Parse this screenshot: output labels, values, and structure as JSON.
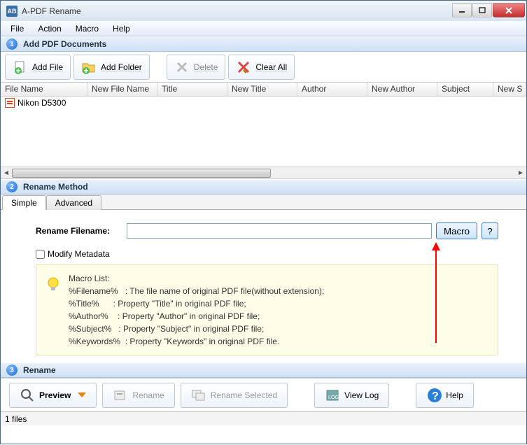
{
  "window": {
    "title": "A-PDF Rename"
  },
  "menu": {
    "file": "File",
    "action": "Action",
    "macro": "Macro",
    "help": "Help"
  },
  "sections": {
    "s1": "Add PDF Documents",
    "s2": "Rename Method",
    "s3": "Rename"
  },
  "toolbar": {
    "add_file": "Add File",
    "add_folder": "Add Folder",
    "delete": "Delete",
    "clear_all": "Clear All"
  },
  "table": {
    "headers": [
      "File Name",
      "New File Name",
      "Title",
      "New Title",
      "Author",
      "New Author",
      "Subject",
      "New S"
    ],
    "rows": [
      {
        "filename": "Nikon D5300"
      }
    ]
  },
  "tabs": {
    "simple": "Simple",
    "advanced": "Advanced"
  },
  "rename": {
    "label": "Rename Filename:",
    "value": "",
    "macro_btn": "Macro",
    "help_btn": "?",
    "modify_meta": "Modify Metadata"
  },
  "macro_list": {
    "title": "Macro List:",
    "l1": "%Filename%   : The file name of original PDF file(without extension);",
    "l2": "%Title%      : Property \"Title\" in original PDF file;",
    "l3": "%Author%    : Property \"Author\" in original PDF file;",
    "l4": "%Subject%   : Property \"Subject\" in original PDF file;",
    "l5": "%Keywords%  : Property \"Keywords\" in original PDF file."
  },
  "bottom": {
    "preview": "Preview",
    "rename": "Rename",
    "rename_selected": "Rename Selected",
    "view_log": "View Log",
    "help": "Help"
  },
  "status": {
    "text": "1 files"
  }
}
